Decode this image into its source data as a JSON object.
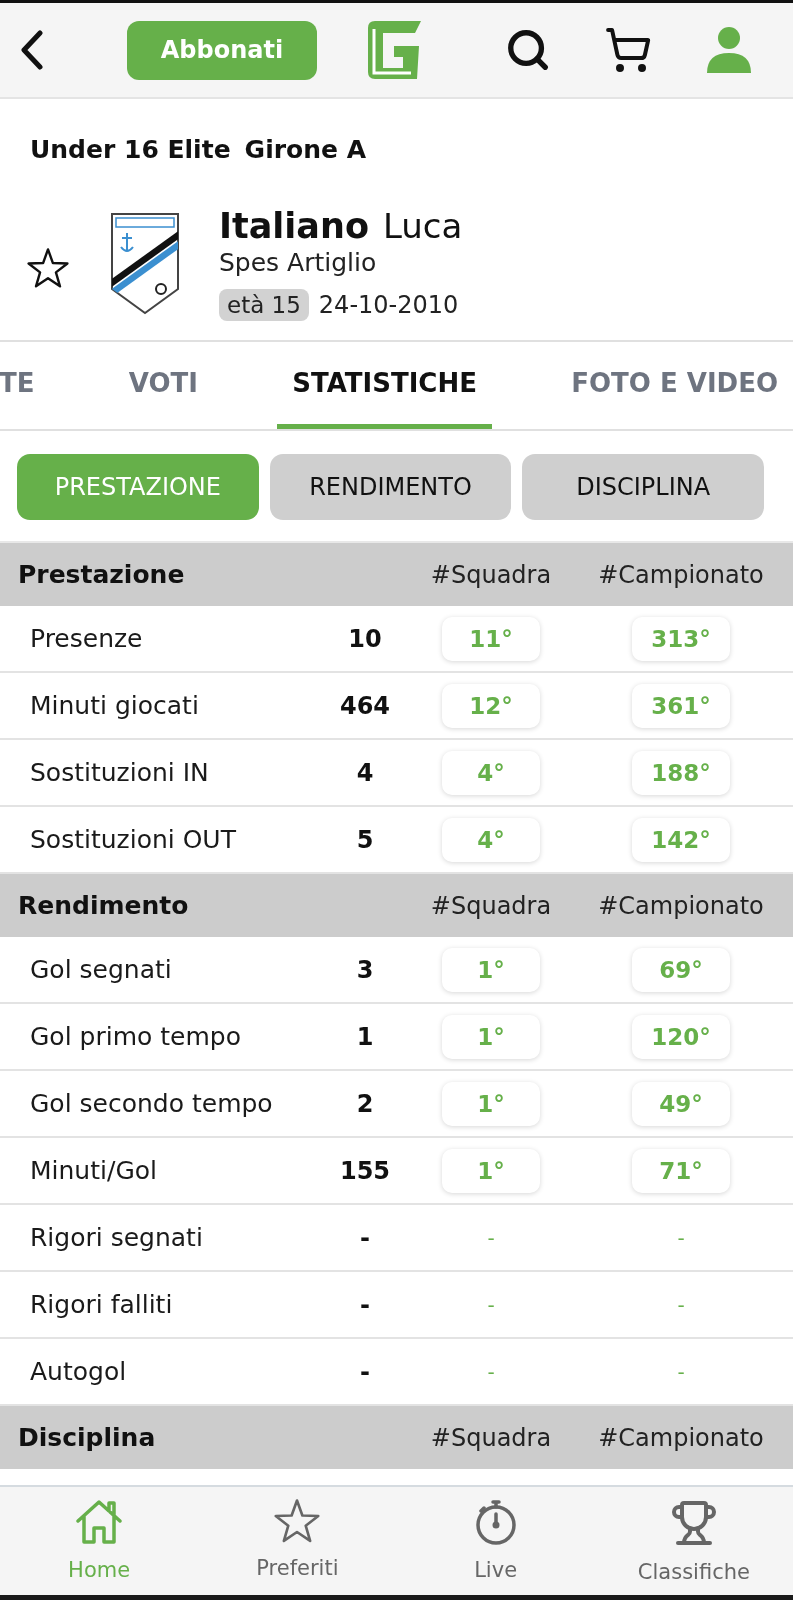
{
  "header": {
    "subscribe_button": "Abbonati"
  },
  "competition": {
    "category": "Under 16 Elite",
    "group": "Girone A"
  },
  "player": {
    "favorite": false,
    "surname": "Italiano",
    "name": "Luca",
    "team": "Spes Artiglio",
    "age": "età 15",
    "birth_date": "24-10-2010"
  },
  "tabs": [
    {
      "label": "TE",
      "selected": false
    },
    {
      "label": "VOTI",
      "selected": false
    },
    {
      "label": "STATISTICHE",
      "selected": true
    },
    {
      "label": "FOTO E VIDEO",
      "selected": false
    }
  ],
  "filters": [
    {
      "label": "PRESTAZIONE",
      "selected": true
    },
    {
      "label": "RENDIMENTO",
      "selected": false
    },
    {
      "label": "DISCIPLINA",
      "selected": false
    }
  ],
  "sections": [
    {
      "title": "Prestazione",
      "team_rank_heading": "#Squadra",
      "league_rank_heading": "#Campionato",
      "rows": [
        {
          "kind": "ranked",
          "label": "Presenze",
          "value": "10",
          "team_rank": "11°",
          "league_rank": "313°"
        },
        {
          "kind": "ranked",
          "label": "Minuti giocati",
          "value": "464",
          "team_rank": "12°",
          "league_rank": "361°"
        },
        {
          "kind": "ranked",
          "label": "Sostituzioni IN",
          "value": "4",
          "team_rank": "4°",
          "league_rank": "188°"
        },
        {
          "kind": "ranked",
          "label": "Sostituzioni OUT",
          "value": "5",
          "team_rank": "4°",
          "league_rank": "142°"
        }
      ]
    },
    {
      "title": "Rendimento",
      "team_rank_heading": "#Squadra",
      "league_rank_heading": "#Campionato",
      "rows": [
        {
          "kind": "ranked",
          "label": "Gol segnati",
          "value": "3",
          "team_rank": "1°",
          "league_rank": "69°"
        },
        {
          "kind": "ranked",
          "label": "Gol primo tempo",
          "value": "1",
          "team_rank": "1°",
          "league_rank": "120°"
        },
        {
          "kind": "ranked",
          "label": "Gol secondo tempo",
          "value": "2",
          "team_rank": "1°",
          "league_rank": "49°"
        },
        {
          "kind": "ranked",
          "label": "Minuti/Gol",
          "value": "155",
          "team_rank": "1°",
          "league_rank": "71°"
        },
        {
          "kind": "unranked",
          "label": "Rigori segnati",
          "value": "-",
          "team_rank": "-",
          "league_rank": "-"
        },
        {
          "kind": "unranked",
          "label": "Rigori falliti",
          "value": "-",
          "team_rank": "-",
          "league_rank": "-"
        },
        {
          "kind": "unranked",
          "label": "Autogol",
          "value": "-",
          "team_rank": "-",
          "league_rank": "-"
        }
      ]
    },
    {
      "title": "Disciplina",
      "team_rank_heading": "#Squadra",
      "league_rank_heading": "#Campionato"
    }
  ],
  "nav": [
    {
      "label": "Home",
      "selected": true
    },
    {
      "label": "Preferiti",
      "selected": false
    },
    {
      "label": "Live",
      "selected": false
    },
    {
      "label": "Classifiche",
      "selected": false
    }
  ]
}
